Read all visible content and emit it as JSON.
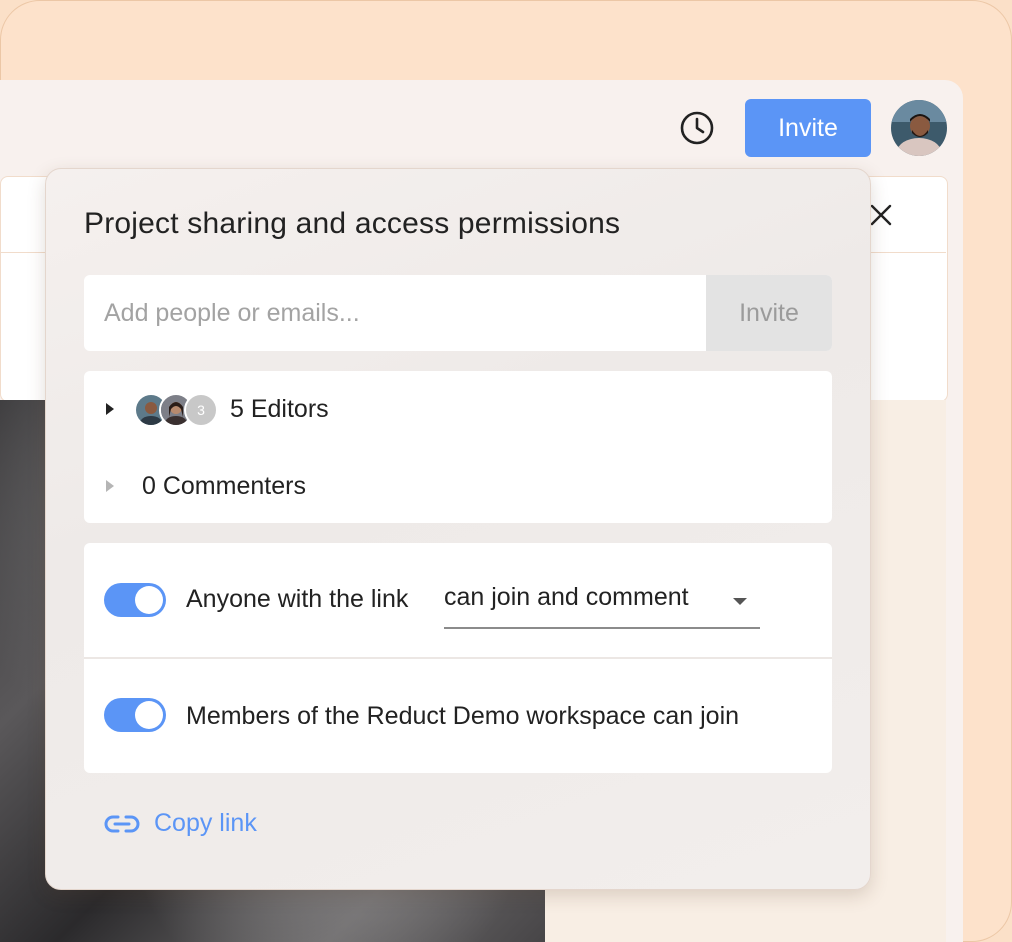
{
  "header": {
    "invite_label": "Invite"
  },
  "modal": {
    "title": "Project sharing and access permissions",
    "invite_input_placeholder": "Add people or emails...",
    "invite_button_label": "Invite",
    "roles": [
      {
        "label": "5 Editors",
        "hidden_count": "3"
      },
      {
        "label": "0 Commenters"
      }
    ],
    "access": {
      "link_prefix": "Anyone with the link",
      "link_permission": "can join and comment",
      "workspace_text": "Members of the Reduct Demo workspace can join"
    },
    "copy_link_label": "Copy link"
  },
  "colors": {
    "accent": "#5b95f6",
    "frame": "#fde2cb"
  },
  "icons": [
    "history-icon",
    "close-icon",
    "caret-right-icon",
    "chevron-down-icon",
    "link-icon"
  ]
}
